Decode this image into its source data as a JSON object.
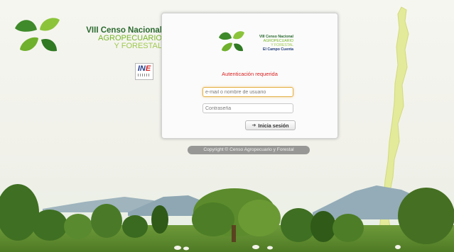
{
  "brand": {
    "line1": "VIII Censo Nacional",
    "line2": "AGROPECUARIO",
    "line3": "Y FORESTAL",
    "partner_logo": "INE"
  },
  "card_logo": {
    "line1": "VIII Censo Nacional",
    "line2": "AGROPECUARIO",
    "line3": "Y FORESTAL",
    "line4": "El Campo Cuenta"
  },
  "login": {
    "message": "Autenticación requerida",
    "username_placeholder": "e-mail o nombre de usuario",
    "username_value": "",
    "password_placeholder": "Contraseña",
    "password_value": "",
    "submit_label": "Inicia sesión",
    "submit_icon": "sign-in-icon"
  },
  "footer": {
    "copyright": "Copyright © Censo Agropecuario y Forestal"
  },
  "colors": {
    "brand_dark_green": "#2a6a2e",
    "brand_green": "#78b62a",
    "brand_light_green": "#9ec94e",
    "error_red": "#d92020",
    "focus_orange": "#e3b24a"
  }
}
